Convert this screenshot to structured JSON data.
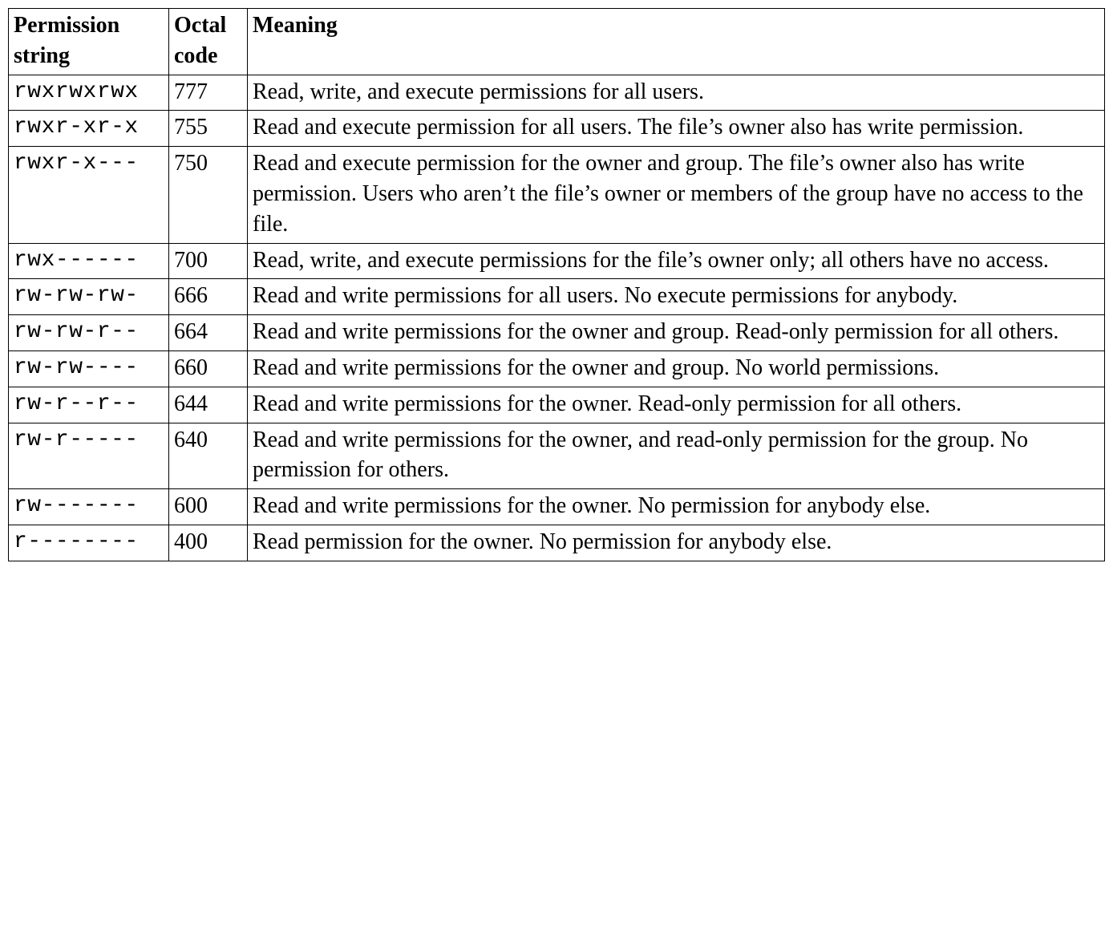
{
  "headers": {
    "permission": "Permission string",
    "octal": "Octal code",
    "meaning": "Meaning"
  },
  "rows": [
    {
      "permission": "rwxrwxrwx",
      "octal": "777",
      "meaning": "Read, write, and execute permissions for all users."
    },
    {
      "permission": "rwxr-xr-x",
      "octal": "755",
      "meaning": "Read and execute permission for all users. The file’s owner also has write permission."
    },
    {
      "permission": "rwxr-x---",
      "octal": "750",
      "meaning": "Read and execute permission for the owner and group. The file’s owner also has write permission. Users who aren’t the file’s owner or members of the group have no access to the file."
    },
    {
      "permission": "rwx------",
      "octal": "700",
      "meaning": "Read, write, and execute permissions for the file’s owner only; all others have no access."
    },
    {
      "permission": "rw-rw-rw-",
      "octal": "666",
      "meaning": "Read and write permissions for all users. No execute permissions for anybody."
    },
    {
      "permission": "rw-rw-r--",
      "octal": "664",
      "meaning": "Read and write permissions for the owner and group. Read-only permission for all others."
    },
    {
      "permission": "rw-rw----",
      "octal": "660",
      "meaning": "Read and write permissions for the owner and group. No world permissions."
    },
    {
      "permission": "rw-r--r--",
      "octal": "644",
      "meaning": "Read and write permissions for the owner. Read-only permission for all others."
    },
    {
      "permission": "rw-r-----",
      "octal": "640",
      "meaning": "Read and write permissions for the owner, and read-only permission for the group. No permission for others."
    },
    {
      "permission": "rw-------",
      "octal": "600",
      "meaning": "Read and write permissions for the owner. No permission for anybody else."
    },
    {
      "permission": "r--------",
      "octal": "400",
      "meaning": "Read permission for the owner. No permission for anybody else."
    }
  ]
}
